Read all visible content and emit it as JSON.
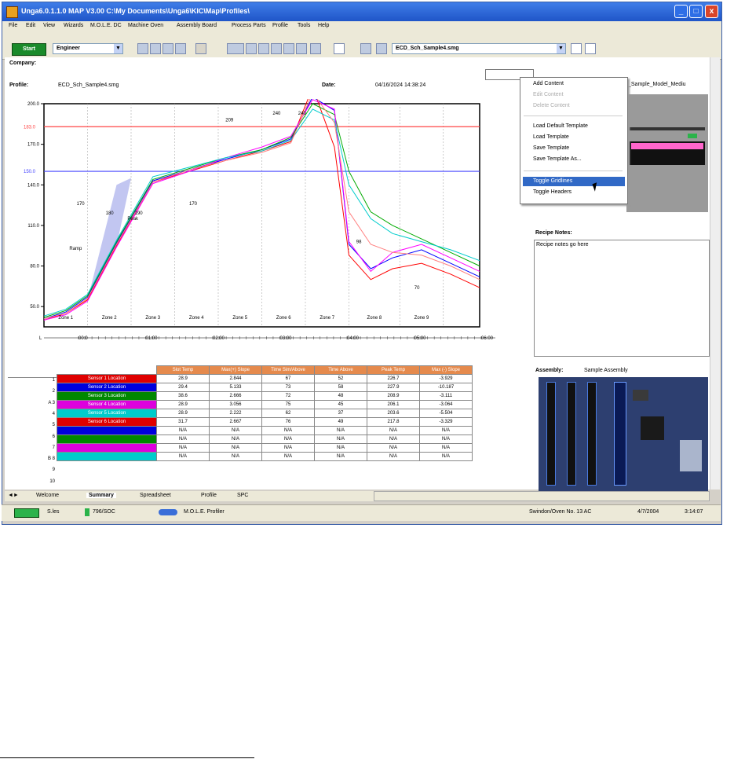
{
  "window": {
    "title": "Unga6.0.1.1.0 MAP V3.00   C:\\My Documents\\Unga6\\KIC\\Map\\Profiles\\",
    "minimize_glyph": "_",
    "maximize_glyph": "□",
    "close_glyph": "x"
  },
  "menu": [
    "File",
    "Edit",
    "View",
    "Wizards",
    "M.O.L.E. DC",
    "Machine Oven",
    "Assembly Board",
    "Process Parts",
    "Profile",
    "Tools",
    "Help"
  ],
  "toolbar": {
    "start_label": "Start",
    "user_combo": "Engineer",
    "profile_combo": "ECD_Sch_Sample4.smg"
  },
  "header": {
    "company_label": "Company:",
    "profile_label": "Profile:",
    "profile_value": "ECD_Sch_Sample4.smg",
    "date_label": "Date:",
    "date_value": "04/16/2024 14:38:24"
  },
  "chart_data": {
    "type": "line",
    "yticks": [
      "200.0",
      "170.0",
      "140.0",
      "110.0",
      "80.0",
      "50.0"
    ],
    "ylim": [
      35,
      200
    ],
    "xticks": [
      "00:0",
      "01:00",
      "02:00",
      "03:00",
      "04:00",
      "05:00",
      "06:00"
    ],
    "xaxis_marker": "L",
    "zones": [
      "Zone 1",
      "Zone 2",
      "Zone 3",
      "Zone 4",
      "Zone 5",
      "Zone 6",
      "Zone 7",
      "Zone 8",
      "Zone 9"
    ],
    "ref_lines": [
      {
        "label": "183.0",
        "y": 183,
        "color": "#ff4444"
      },
      {
        "label": "150.0",
        "y": 150,
        "color": "#4444ff"
      }
    ],
    "annotations": [
      "170",
      "180",
      "Peak",
      "190",
      "170",
      "209",
      "240",
      "240",
      "Ramp",
      "98",
      "70"
    ],
    "series": [
      {
        "color": "#ff0000",
        "x": [
          0,
          0.3,
          0.6,
          1.0,
          1.5,
          2.0,
          2.5,
          3.0,
          3.4,
          3.7,
          4.0,
          4.2,
          4.5,
          4.8,
          5.2,
          5.6,
          6.0
        ],
        "y": [
          40,
          45,
          55,
          95,
          142,
          150,
          158,
          165,
          172,
          212,
          168,
          88,
          70,
          78,
          82,
          74,
          64
        ]
      },
      {
        "color": "#0000ff",
        "x": [
          0,
          0.3,
          0.6,
          1.0,
          1.5,
          2.0,
          2.5,
          3.0,
          3.4,
          3.7,
          4.0,
          4.2,
          4.5,
          4.8,
          5.2,
          5.6,
          6.0
        ],
        "y": [
          41,
          46,
          57,
          97,
          143,
          151,
          159,
          166,
          174,
          205,
          195,
          96,
          78,
          86,
          92,
          82,
          72
        ]
      },
      {
        "color": "#00aa00",
        "x": [
          0,
          0.3,
          0.6,
          1.0,
          1.5,
          2.0,
          2.5,
          3.0,
          3.4,
          3.7,
          4.0,
          4.2,
          4.5,
          4.8,
          5.2,
          5.6,
          6.0
        ],
        "y": [
          42,
          47,
          58,
          98,
          144,
          152,
          160,
          166,
          175,
          200,
          192,
          150,
          120,
          110,
          100,
          90,
          80
        ]
      },
      {
        "color": "#ff00ff",
        "x": [
          0,
          0.3,
          0.6,
          1.0,
          1.5,
          2.0,
          2.5,
          3.0,
          3.4,
          3.7,
          4.0,
          4.2,
          4.5,
          4.8,
          5.2,
          5.6,
          6.0
        ],
        "y": [
          40,
          44,
          54,
          94,
          141,
          150,
          160,
          168,
          176,
          203,
          196,
          98,
          76,
          90,
          96,
          86,
          76
        ]
      },
      {
        "color": "#00cccc",
        "x": [
          0,
          0.3,
          0.6,
          1.0,
          1.5,
          2.0,
          2.5,
          3.0,
          3.4,
          3.7,
          4.0,
          4.2,
          4.5,
          4.8,
          5.2,
          5.6,
          6.0
        ],
        "y": [
          43,
          48,
          59,
          99,
          146,
          153,
          160,
          165,
          173,
          196,
          188,
          140,
          115,
          104,
          98,
          92,
          84
        ]
      },
      {
        "color": "#ff8080",
        "x": [
          0,
          0.3,
          0.6,
          1.0,
          1.5,
          2.0,
          2.5,
          3.0,
          3.4,
          3.7,
          4.0,
          4.2,
          4.5,
          4.8,
          5.2,
          5.6,
          6.0
        ],
        "y": [
          41,
          45,
          56,
          96,
          142,
          151,
          158,
          164,
          171,
          208,
          186,
          120,
          96,
          90,
          88,
          80,
          70
        ]
      }
    ]
  },
  "table": {
    "headers": [
      "Slot Temp",
      "Max(+) Slope",
      "Time Sim/Above",
      "Time Above",
      "Peak Temp",
      "Max (-) Slope"
    ],
    "rows": [
      {
        "idx": "1",
        "name": "Sensor 1 Location",
        "color": "#e00000",
        "cells": [
          "28.9",
          "2.844",
          "67",
          "52",
          "226.7",
          "-3.929"
        ]
      },
      {
        "idx": "2",
        "name": "Sensor 2 Location",
        "color": "#0000dd",
        "cells": [
          "29.4",
          "5.133",
          "73",
          "58",
          "227.9",
          "-10.187"
        ]
      },
      {
        "idx": "A 3",
        "name": "Sensor 3 Location",
        "color": "#008800",
        "cells": [
          "38.6",
          "2.666",
          "72",
          "48",
          "208.9",
          "-3.111"
        ]
      },
      {
        "idx": "4",
        "name": "Sensor 4 Location",
        "color": "#dd00dd",
        "cells": [
          "28.9",
          "3.056",
          "75",
          "45",
          "206.1",
          "-3.064"
        ]
      },
      {
        "idx": "5",
        "name": "Sensor 5 Location",
        "color": "#00cccc",
        "cells": [
          "28.9",
          "2.222",
          "62",
          "37",
          "203.6",
          "-5.504"
        ]
      },
      {
        "idx": "6",
        "name": "Sensor 6 Location",
        "color": "#e00000",
        "cells": [
          "31.7",
          "2.667",
          "76",
          "49",
          "217.8",
          "-3.329"
        ]
      },
      {
        "idx": "7",
        "name": "",
        "color": "#0000dd",
        "cells": [
          "N/A",
          "N/A",
          "N/A",
          "N/A",
          "N/A",
          "N/A"
        ]
      },
      {
        "idx": "B 8",
        "name": "",
        "color": "#008800",
        "cells": [
          "N/A",
          "N/A",
          "N/A",
          "N/A",
          "N/A",
          "N/A"
        ]
      },
      {
        "idx": "9",
        "name": "",
        "color": "#dd00dd",
        "cells": [
          "N/A",
          "N/A",
          "N/A",
          "N/A",
          "N/A",
          "N/A"
        ]
      },
      {
        "idx": "10",
        "name": "",
        "color": "#00cccc",
        "cells": [
          "N/A",
          "N/A",
          "N/A",
          "N/A",
          "N/A",
          "N/A"
        ]
      }
    ]
  },
  "context_menu": {
    "items": [
      {
        "label": "Add Content",
        "enabled": true
      },
      {
        "label": "Edit Content",
        "enabled": false
      },
      {
        "label": "Delete Content",
        "enabled": false
      },
      {
        "label": "Load Default Template",
        "enabled": true
      },
      {
        "label": "Load Template",
        "enabled": true
      },
      {
        "label": "Save Template",
        "enabled": true
      },
      {
        "label": "Save Template As...",
        "enabled": true
      },
      {
        "label": "Toggle Gridlines",
        "enabled": true
      },
      {
        "label": "Toggle Headers",
        "enabled": true
      }
    ]
  },
  "right_panel": {
    "model_label": "_Sample_Model_Mediu",
    "recipe_notes_label": "Recipe Notes:",
    "recipe_notes_text": "Recipe notes go here",
    "assembly_label": "Assembly:",
    "assembly_value": "Sample Assembly"
  },
  "tabs": [
    "Welcome",
    "Summary",
    "Spreadsheet",
    "Profile",
    "SPC"
  ],
  "statusbar": {
    "s1": "S.les",
    "s2": "796/SOC",
    "s3": "M.O.L.E. Profiler",
    "s4": "Swindon/Oven No. 13 AC",
    "s5": "4/7/2004",
    "s6": "3:14:07"
  }
}
